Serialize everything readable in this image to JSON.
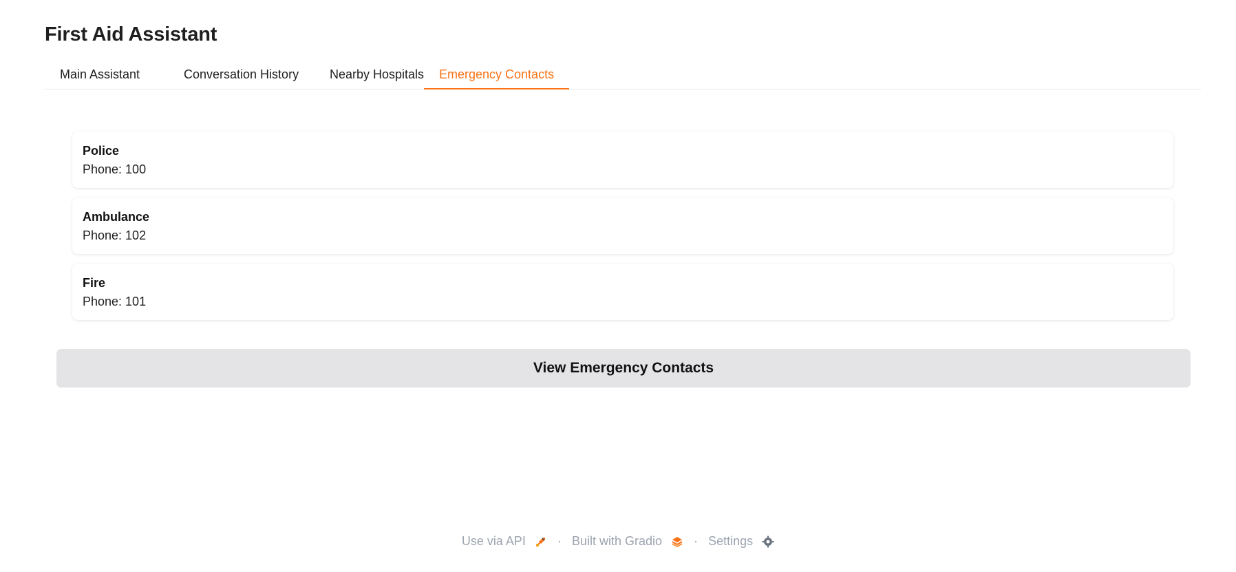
{
  "app": {
    "title": "First Aid Assistant"
  },
  "tabs": [
    {
      "label": "Main Assistant"
    },
    {
      "label": "Conversation History"
    },
    {
      "label": "Nearby Hospitals"
    },
    {
      "label": "Emergency Contacts",
      "active": true
    }
  ],
  "contacts": [
    {
      "name": "Police",
      "phone": "Phone: 100"
    },
    {
      "name": "Ambulance",
      "phone": "Phone: 102"
    },
    {
      "name": "Fire",
      "phone": "Phone: 101"
    }
  ],
  "button": {
    "label": "View Emergency Contacts"
  },
  "footer": {
    "api_label": "Use via API",
    "built_label": "Built with Gradio",
    "settings_label": "Settings",
    "separator": "·",
    "icons": [
      "rocket-icon",
      "gradio-logo-icon",
      "gear-icon"
    ]
  },
  "colors": {
    "accent": "#f97316",
    "button_bg": "#e4e4e7",
    "footer_text": "#9ca3af"
  }
}
